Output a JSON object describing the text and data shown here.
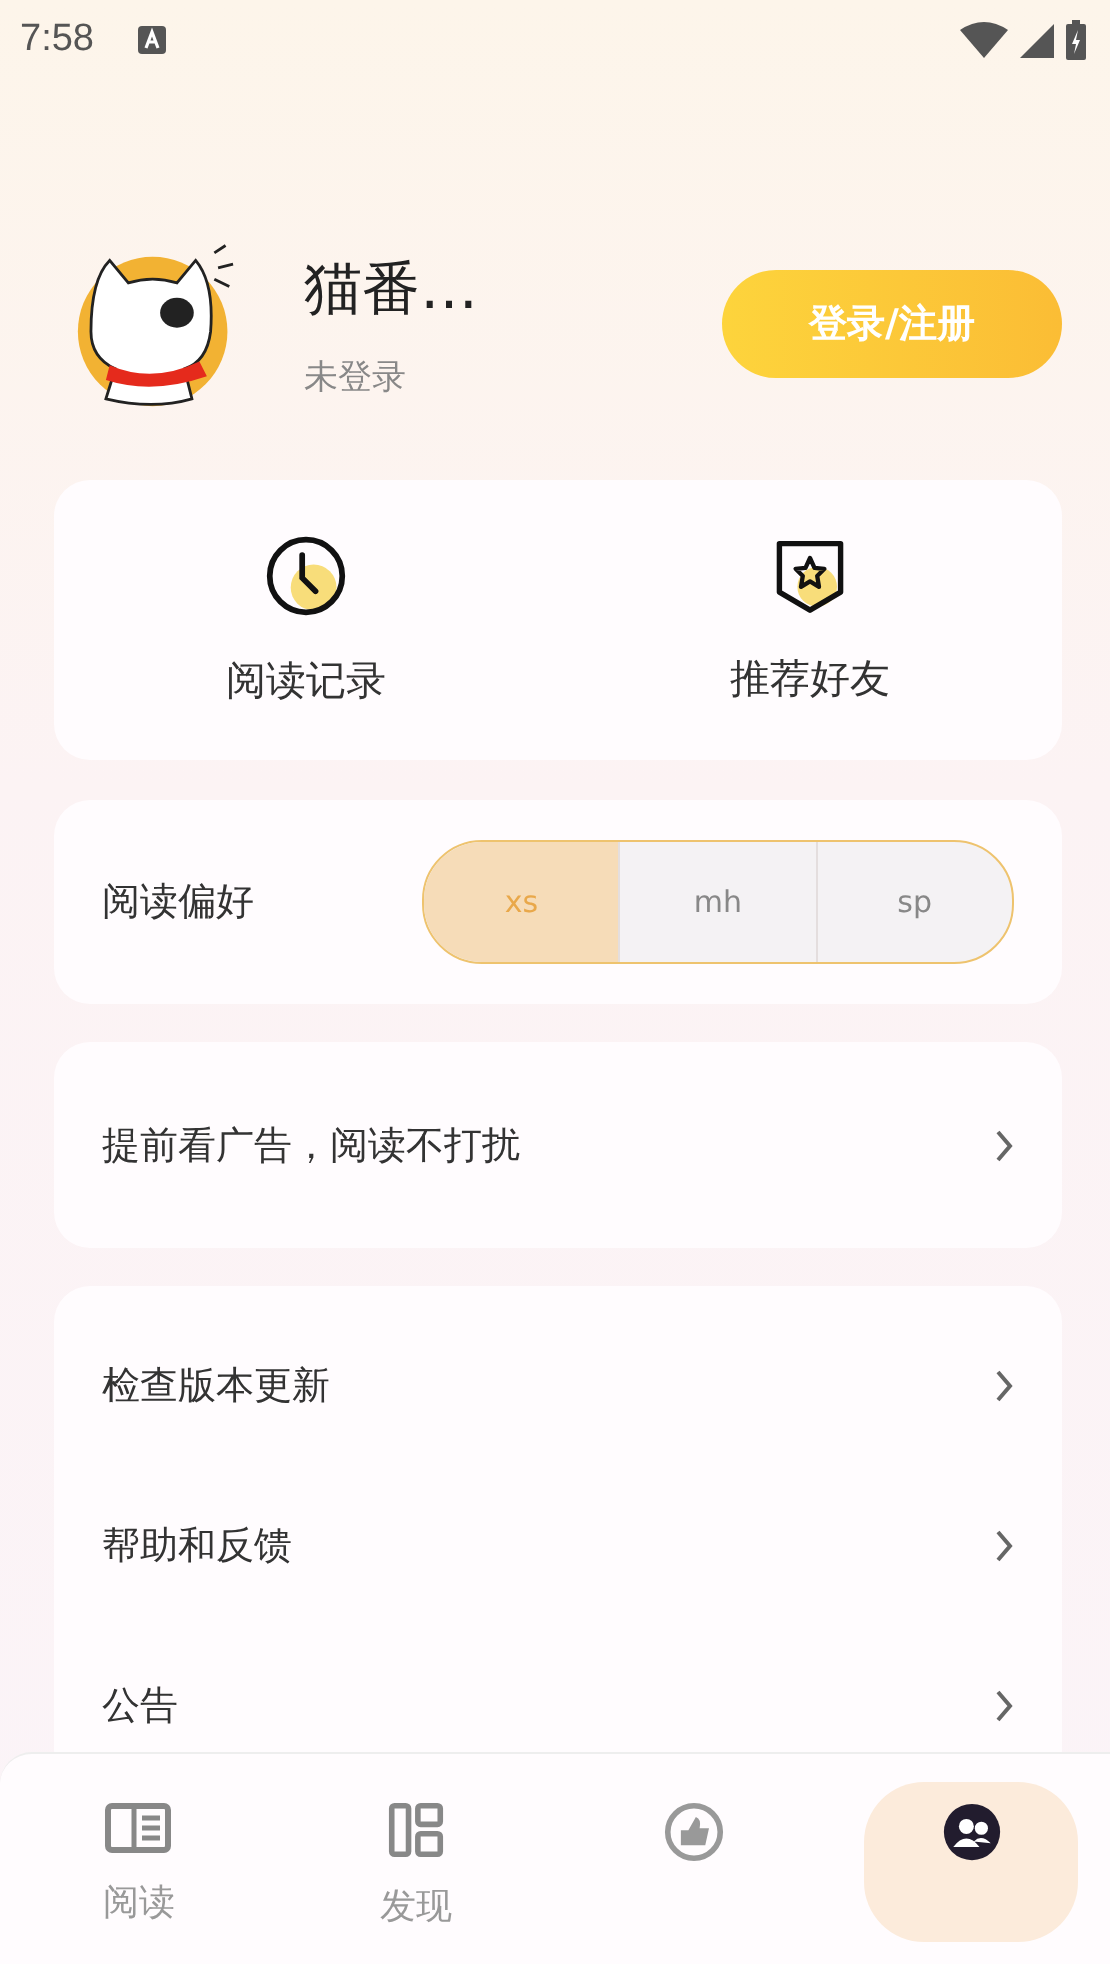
{
  "status_bar": {
    "time": "7:58"
  },
  "profile": {
    "name": "猫番…",
    "status": "未登录",
    "login_button": "登录/注册"
  },
  "shortcuts": [
    {
      "label": "阅读记录"
    },
    {
      "label": "推荐好友"
    }
  ],
  "reading_preference": {
    "label": "阅读偏好",
    "options": [
      {
        "label": "xs",
        "selected": true
      },
      {
        "label": "mh",
        "selected": false
      },
      {
        "label": "sp",
        "selected": false
      }
    ]
  },
  "ad_row": {
    "label": "提前看广告，阅读不打扰"
  },
  "menu": [
    {
      "label": "检查版本更新"
    },
    {
      "label": "帮助和反馈"
    },
    {
      "label": "公告"
    }
  ],
  "tab_bar": [
    {
      "label": "阅读",
      "selected": false
    },
    {
      "label": "发现",
      "selected": false
    },
    {
      "selected": false
    },
    {
      "selected": true
    }
  ]
}
